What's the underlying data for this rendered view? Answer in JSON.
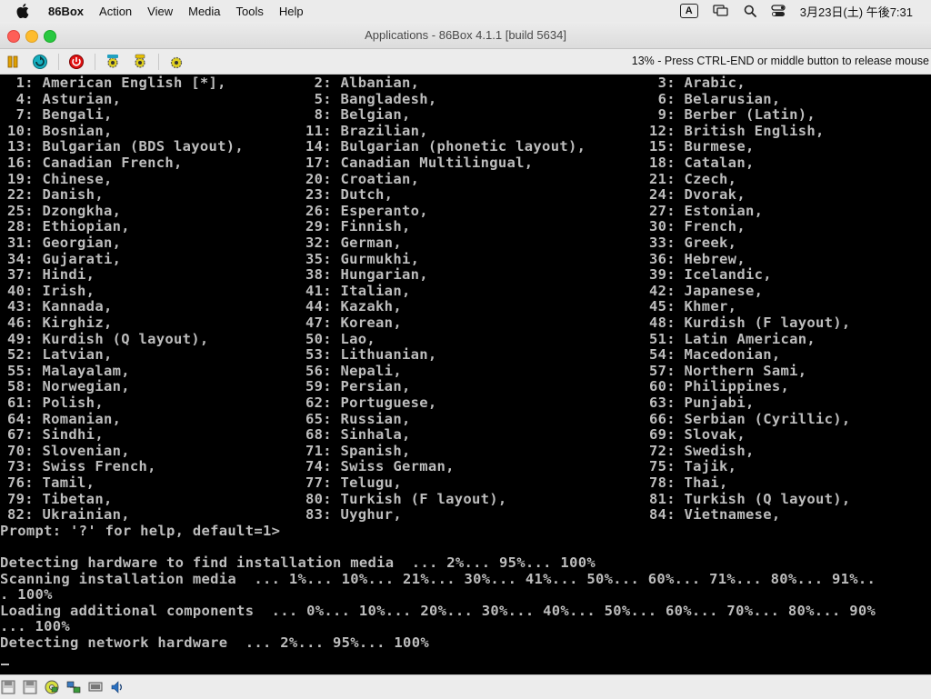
{
  "menubar": {
    "app_name": "86Box",
    "items": [
      "Action",
      "View",
      "Media",
      "Tools",
      "Help"
    ],
    "ime_indicator": "A",
    "clock": "3月23日(土) 午後7:31"
  },
  "window": {
    "title": "Applications - 86Box 4.1.1 [build 5634]"
  },
  "toolbar": {
    "status_text": "13% - Press CTRL-END or middle button to release mouse",
    "icons": [
      "pause-icon",
      "reset-icon",
      "power-icon",
      "settings-icon",
      "ctrl-alt-del-icon",
      "ctrl-alt-esc-icon"
    ]
  },
  "screen": {
    "colors": {
      "text": "#bdbdbd",
      "background": "#000000"
    },
    "keyboard_rows": [
      [
        " 1: American English [*],",
        " 2: Albanian,",
        " 3: Arabic,"
      ],
      [
        " 4: Asturian,",
        " 5: Bangladesh,",
        " 6: Belarusian,"
      ],
      [
        " 7: Bengali,",
        " 8: Belgian,",
        " 9: Berber (Latin),"
      ],
      [
        "10: Bosnian,",
        "11: Brazilian,",
        "12: British English,"
      ],
      [
        "13: Bulgarian (BDS layout),",
        "14: Bulgarian (phonetic layout),",
        "15: Burmese,"
      ],
      [
        "16: Canadian French,",
        "17: Canadian Multilingual,",
        "18: Catalan,"
      ],
      [
        "19: Chinese,",
        "20: Croatian,",
        "21: Czech,"
      ],
      [
        "22: Danish,",
        "23: Dutch,",
        "24: Dvorak,"
      ],
      [
        "25: Dzongkha,",
        "26: Esperanto,",
        "27: Estonian,"
      ],
      [
        "28: Ethiopian,",
        "29: Finnish,",
        "30: French,"
      ],
      [
        "31: Georgian,",
        "32: German,",
        "33: Greek,"
      ],
      [
        "34: Gujarati,",
        "35: Gurmukhi,",
        "36: Hebrew,"
      ],
      [
        "37: Hindi,",
        "38: Hungarian,",
        "39: Icelandic,"
      ],
      [
        "40: Irish,",
        "41: Italian,",
        "42: Japanese,"
      ],
      [
        "43: Kannada,",
        "44: Kazakh,",
        "45: Khmer,"
      ],
      [
        "46: Kirghiz,",
        "47: Korean,",
        "48: Kurdish (F layout),"
      ],
      [
        "49: Kurdish (Q layout),",
        "50: Lao,",
        "51: Latin American,"
      ],
      [
        "52: Latvian,",
        "53: Lithuanian,",
        "54: Macedonian,"
      ],
      [
        "55: Malayalam,",
        "56: Nepali,",
        "57: Northern Sami,"
      ],
      [
        "58: Norwegian,",
        "59: Persian,",
        "60: Philippines,"
      ],
      [
        "61: Polish,",
        "62: Portuguese,",
        "63: Punjabi,"
      ],
      [
        "64: Romanian,",
        "65: Russian,",
        "66: Serbian (Cyrillic),"
      ],
      [
        "67: Sindhi,",
        "68: Sinhala,",
        "69: Slovak,"
      ],
      [
        "70: Slovenian,",
        "71: Spanish,",
        "72: Swedish,"
      ],
      [
        "73: Swiss French,",
        "74: Swiss German,",
        "75: Tajik,"
      ],
      [
        "76: Tamil,",
        "77: Telugu,",
        "78: Thai,"
      ],
      [
        "79: Tibetan,",
        "80: Turkish (F layout),",
        "81: Turkish (Q layout),"
      ],
      [
        "82: Ukrainian,",
        "83: Uyghur,",
        "84: Vietnamese,"
      ]
    ],
    "prompt": "Prompt: '?' for help, default=1>",
    "log_lines": [
      "",
      "Detecting hardware to find installation media  ... 2%... 95%... 100%",
      "Scanning installation media  ... 1%... 10%... 21%... 30%... 41%... 50%... 60%... 71%... 80%... 91%..",
      ". 100%",
      "Loading additional components  ... 0%... 10%... 20%... 30%... 40%... 50%... 60%... 70%... 80%... 90%",
      "... 100%",
      "Detecting network hardware  ... 2%... 95%... 100%"
    ]
  },
  "statusbar": {
    "icons": [
      "floppy-icon",
      "floppy-2-icon",
      "cdrom-icon",
      "network-icon",
      "display-icon",
      "sound-icon"
    ]
  }
}
